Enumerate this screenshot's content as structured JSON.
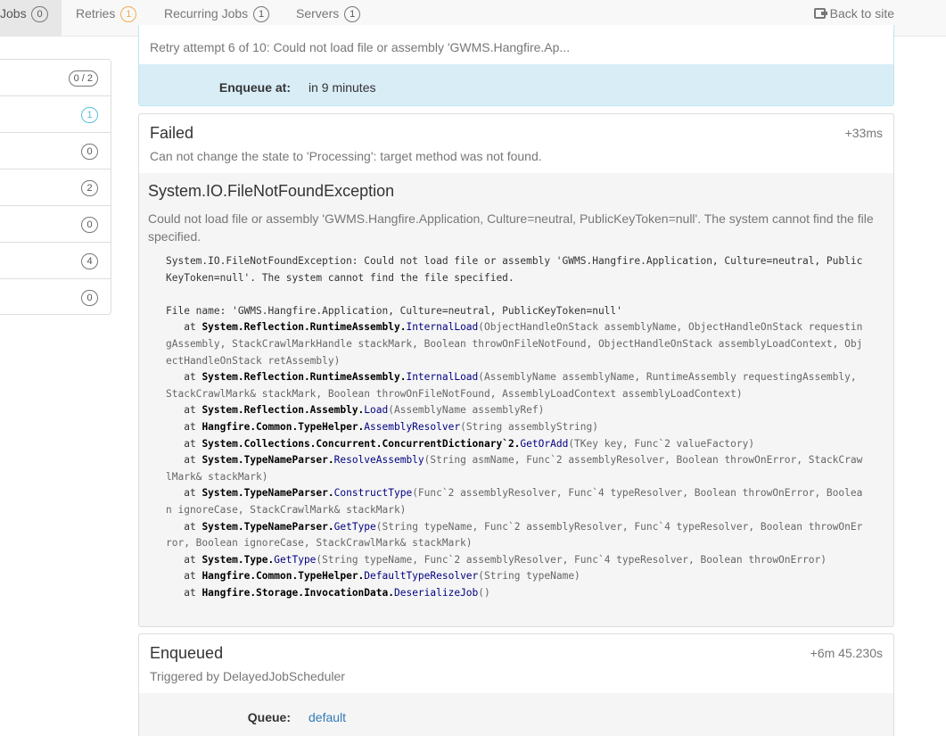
{
  "nav": {
    "items": [
      {
        "label": "Jobs",
        "count": "0",
        "active": true
      },
      {
        "label": "Retries",
        "count": "1",
        "active": false
      },
      {
        "label": "Recurring Jobs",
        "count": "1",
        "active": false
      },
      {
        "label": "Servers",
        "count": "1",
        "active": false
      }
    ],
    "back_label": "Back to site",
    "back_icon": "sign-out-icon"
  },
  "sidebar": {
    "badges": [
      "0 / 2",
      "1",
      "0",
      "2",
      "0",
      "4",
      "0"
    ]
  },
  "scheduled": {
    "reason": "Retry attempt 6 of 10: Could not load file or assembly 'GWMS.Hangfire.Ap...",
    "enqueue_key": "Enqueue at:",
    "enqueue_value": "in 9 minutes"
  },
  "failed": {
    "title": "Failed",
    "time": "+33ms",
    "reason": "Can not change the state to 'Processing': target method was not found.",
    "exception_type": "System.IO.FileNotFoundException",
    "exception_message": "Could not load file or assembly 'GWMS.Hangfire.Application, Culture=neutral, PublicKeyToken=null'. The system cannot find the file specified.",
    "stack_intro": "System.IO.FileNotFoundException: Could not load file or assembly 'GWMS.Hangfire.Application, Culture=neutral, PublicKeyToken=null'. The system cannot find the file specified.",
    "file_name_line": "File name: 'GWMS.Hangfire.Application, Culture=neutral, PublicKeyToken=null'",
    "frames": [
      {
        "type": "System.Reflection.RuntimeAssembly.",
        "method": "InternalLoad",
        "args": "(ObjectHandleOnStack assemblyName, ObjectHandleOnStack requestingAssembly, StackCrawlMarkHandle stackMark, Boolean throwOnFileNotFound, ObjectHandleOnStack assemblyLoadContext, ObjectHandleOnStack retAssembly)"
      },
      {
        "type": "System.Reflection.RuntimeAssembly.",
        "method": "InternalLoad",
        "args": "(AssemblyName assemblyName, RuntimeAssembly requestingAssembly, StackCrawlMark& stackMark, Boolean throwOnFileNotFound, AssemblyLoadContext assemblyLoadContext)"
      },
      {
        "type": "System.Reflection.Assembly.",
        "method": "Load",
        "args": "(AssemblyName assemblyRef)"
      },
      {
        "type": "Hangfire.Common.TypeHelper.",
        "method": "AssemblyResolver",
        "args": "(String assemblyString)"
      },
      {
        "type": "System.Collections.Concurrent.ConcurrentDictionary`2.",
        "method": "GetOrAdd",
        "args": "(TKey key, Func`2 valueFactory)"
      },
      {
        "type": "System.TypeNameParser.",
        "method": "ResolveAssembly",
        "args": "(String asmName, Func`2 assemblyResolver, Boolean throwOnError, StackCrawlMark& stackMark)"
      },
      {
        "type": "System.TypeNameParser.",
        "method": "ConstructType",
        "args": "(Func`2 assemblyResolver, Func`4 typeResolver, Boolean throwOnError, Boolean ignoreCase, StackCrawlMark& stackMark)"
      },
      {
        "type": "System.TypeNameParser.",
        "method": "GetType",
        "args": "(String typeName, Func`2 assemblyResolver, Func`4 typeResolver, Boolean throwOnError, Boolean ignoreCase, StackCrawlMark& stackMark)"
      },
      {
        "type": "System.Type.",
        "method": "GetType",
        "args": "(String typeName, Func`2 assemblyResolver, Func`4 typeResolver, Boolean throwOnError)"
      },
      {
        "type": "Hangfire.Common.TypeHelper.",
        "method": "DefaultTypeResolver",
        "args": "(String typeName)"
      },
      {
        "type": "Hangfire.Storage.InvocationData.",
        "method": "DeserializeJob",
        "args": "()"
      }
    ]
  },
  "enqueued": {
    "title": "Enqueued",
    "time": "+6m 45.230s",
    "reason": "Triggered by DelayedJobScheduler",
    "queue_key": "Queue:",
    "queue_value": "default"
  },
  "colors": {
    "info_bg": "#d9edf7",
    "info_border": "#bce8f1",
    "warning": "#f0ad4e",
    "link": "#337ab7"
  }
}
